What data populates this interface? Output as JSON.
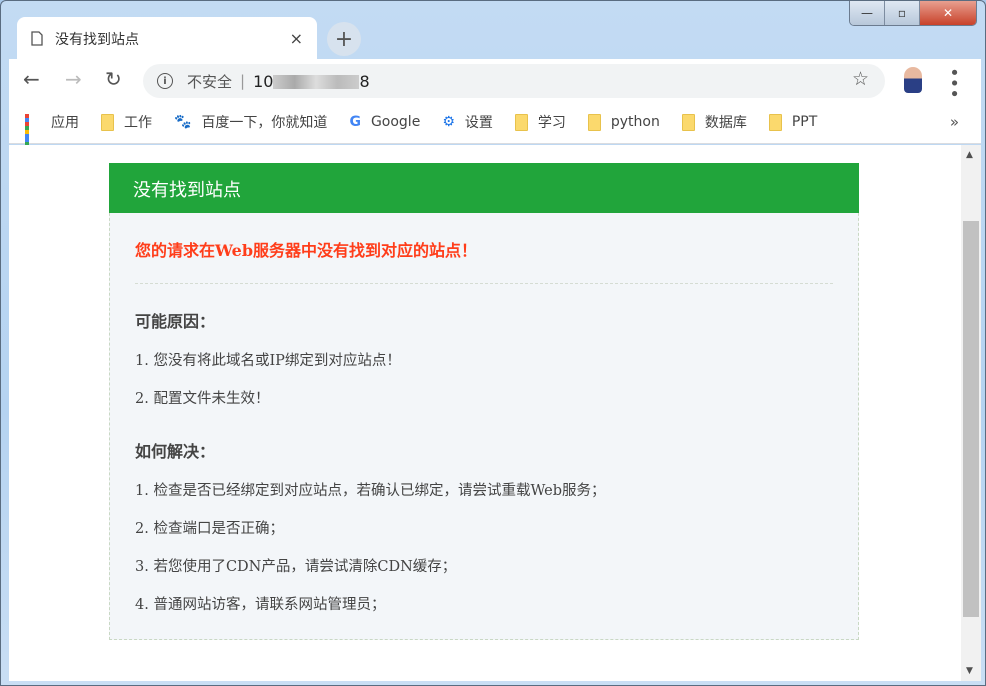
{
  "window": {
    "min": "—",
    "max": "▫",
    "close": "✕"
  },
  "tab": {
    "title": "没有找到站点",
    "close": "×",
    "new": "+"
  },
  "omnibox": {
    "insecure": "不安全",
    "url_prefix": "10",
    "url_suffix": "8"
  },
  "bookmarks": [
    {
      "label": "应用",
      "icon": "apps-icon"
    },
    {
      "label": "工作",
      "icon": "folder-icon"
    },
    {
      "label": "百度一下，你就知道",
      "icon": "baidu-icon"
    },
    {
      "label": "Google",
      "icon": "google-icon"
    },
    {
      "label": "设置",
      "icon": "gear-icon"
    },
    {
      "label": "学习",
      "icon": "folder-icon"
    },
    {
      "label": "python",
      "icon": "folder-icon"
    },
    {
      "label": "数据库",
      "icon": "folder-icon"
    },
    {
      "label": "PPT",
      "icon": "folder-icon"
    }
  ],
  "page": {
    "header": "没有找到站点",
    "error": "您的请求在Web服务器中没有找到对应的站点！",
    "reasons_title": "可能原因：",
    "reasons": [
      "1. 您没有将此域名或IP绑定到对应站点！",
      "2. 配置文件未生效！"
    ],
    "solutions_title": "如何解决：",
    "solutions": [
      "1. 检查是否已经绑定到对应站点，若确认已绑定，请尝试重载Web服务；",
      "2. 检查端口是否正确；",
      "3. 若您使用了CDN产品，请尝试清除CDN缓存；",
      "4. 普通网站访客，请联系网站管理员；"
    ]
  },
  "colors": {
    "header_green": "#21a53b",
    "error_red": "#ff3d1a"
  }
}
